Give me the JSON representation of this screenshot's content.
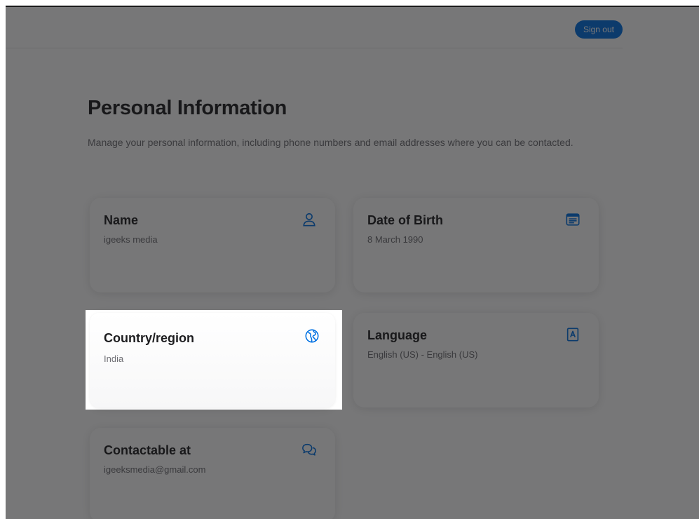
{
  "header": {
    "signout_label": "Sign out"
  },
  "page": {
    "title": "Personal Information",
    "subtitle": "Manage your personal information, including phone numbers and email addresses where you can be contacted."
  },
  "cards": {
    "name": {
      "label": "Name",
      "value": "igeeks media",
      "icon": "person-icon"
    },
    "dob": {
      "label": "Date of Birth",
      "value": "8 March 1990",
      "icon": "calendar-icon"
    },
    "country": {
      "label": "Country/region",
      "value": "India",
      "icon": "globe-icon"
    },
    "language": {
      "label": "Language",
      "value": "English (US) - English (US)",
      "icon": "language-book-icon"
    },
    "contact": {
      "label": "Contactable at",
      "value": "igeeksmedia@gmail.com",
      "icon": "chat-bubbles-icon"
    }
  },
  "colors": {
    "accent": "#0071e3",
    "text": "#1d1d1f",
    "secondary": "#6e6e73"
  }
}
